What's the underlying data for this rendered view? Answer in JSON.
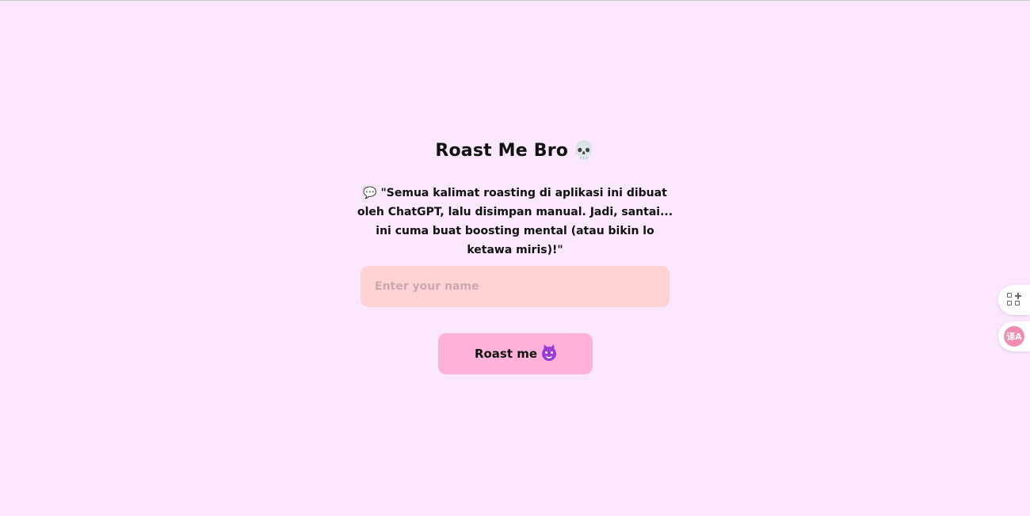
{
  "app": {
    "title": "Roast Me Bro",
    "title_emoji": "💀"
  },
  "description": {
    "icon": "speech-bubble-icon",
    "text": "💬 \"Semua kalimat roasting di aplikasi ini dibuat oleh ChatGPT, lalu disimpan manual. Jadi, santai... ini cuma buat boosting mental (atau bikin lo ketawa miris)!\""
  },
  "form": {
    "name_input": {
      "value": "",
      "placeholder": "Enter your name"
    },
    "submit": {
      "label": "Roast me",
      "icon": "smiling-devil-icon"
    }
  },
  "side_widgets": {
    "apps": {
      "icon": "apps-add-icon"
    },
    "translate": {
      "icon": "translate-icon",
      "glyph": "译A"
    }
  },
  "colors": {
    "background": "#fbe7fe",
    "input_background": "#ffd3d6",
    "button_background": "#ffb2d9",
    "translate_accent": "#f08db0"
  }
}
